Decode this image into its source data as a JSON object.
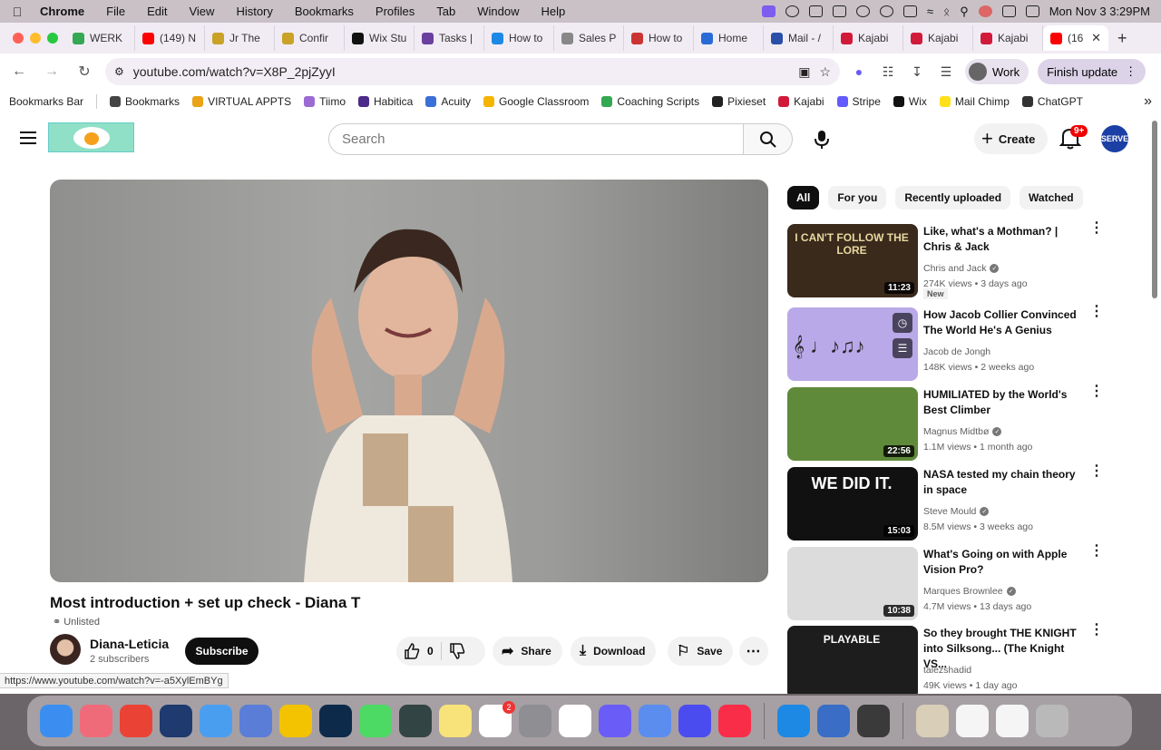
{
  "menubar": {
    "app": "Chrome",
    "items": [
      "File",
      "Edit",
      "View",
      "History",
      "Bookmarks",
      "Profiles",
      "Tab",
      "Window",
      "Help"
    ],
    "datetime": "Mon Nov 3  3:29PM"
  },
  "tabs": [
    {
      "label": "WERK",
      "color": "#34a853"
    },
    {
      "label": "(149) N",
      "color": "#ff0000"
    },
    {
      "label": "Jr The",
      "color": "#c9a227"
    },
    {
      "label": "Confir",
      "color": "#c9a227"
    },
    {
      "label": "Wix Stu",
      "color": "#111111"
    },
    {
      "label": "Tasks |",
      "color": "#6b3fa0"
    },
    {
      "label": "How to",
      "color": "#1e88e5"
    },
    {
      "label": "Sales P",
      "color": "#888888"
    },
    {
      "label": "How to",
      "color": "#cc3333"
    },
    {
      "label": "Home",
      "color": "#2a6ad6"
    },
    {
      "label": "Mail - /",
      "color": "#2a4fa8"
    },
    {
      "label": "Kajabi",
      "color": "#d11a3a"
    },
    {
      "label": "Kajabi",
      "color": "#d11a3a"
    },
    {
      "label": "Kajabi",
      "color": "#d11a3a"
    },
    {
      "label": "(16",
      "color": "#ff0000",
      "active": true
    }
  ],
  "toolbar": {
    "url": "youtube.com/watch?v=X8P_2pjZyyI",
    "profile_label": "Work",
    "update_label": "Finish update"
  },
  "bookmarks": [
    {
      "label": "Bookmarks Bar",
      "color": ""
    },
    {
      "label": "Bookmarks",
      "color": "#444444"
    },
    {
      "label": "VIRTUAL APPTS",
      "color": "#e8a317"
    },
    {
      "label": "Tiimo",
      "color": "#9b6bd3"
    },
    {
      "label": "Habitica",
      "color": "#4b2a8a"
    },
    {
      "label": "Acuity",
      "color": "#3b6fd8"
    },
    {
      "label": "Google Classroom",
      "color": "#f4b400"
    },
    {
      "label": "Coaching Scripts",
      "color": "#34a853"
    },
    {
      "label": "Pixieset",
      "color": "#222222"
    },
    {
      "label": "Kajabi",
      "color": "#d11a3a"
    },
    {
      "label": "Stripe",
      "color": "#635bff"
    },
    {
      "label": "Wix",
      "color": "#111111"
    },
    {
      "label": "Mail Chimp",
      "color": "#ffe01b"
    },
    {
      "label": "ChatGPT",
      "color": "#333333"
    }
  ],
  "youtube": {
    "search_placeholder": "Search",
    "create_label": "Create",
    "notification_count": "9+",
    "avatar_text": "SERVE"
  },
  "video": {
    "title": "Most introduction + set up check - Diana T",
    "visibility": "Unlisted",
    "channel": "Diana-Leticia",
    "subscribers": "2 subscribers",
    "subscribe_label": "Subscribe",
    "likes": "0",
    "share_label": "Share",
    "download_label": "Download",
    "save_label": "Save"
  },
  "chips": [
    "All",
    "For you",
    "Recently uploaded",
    "Watched"
  ],
  "recommendations": [
    {
      "title": "Like, what's a Mothman? | Chris & Jack",
      "channel": "Chris and Jack",
      "verified": true,
      "meta": "274K views • 3 days ago",
      "duration": "11:23",
      "badge": "New",
      "thumb": "#3a2a1c"
    },
    {
      "title": "How Jacob Collier Convinced The World He's A Genius",
      "channel": "Jacob de Jongh",
      "verified": false,
      "meta": "148K views • 2 weeks ago",
      "duration": "",
      "badge": "",
      "thumb": "#b9a9e8"
    },
    {
      "title": "HUMILIATED by the World's Best Climber",
      "channel": "Magnus Midtbø",
      "verified": true,
      "meta": "1.1M views • 1 month ago",
      "duration": "22:56",
      "badge": "",
      "thumb": "#5e8a3a"
    },
    {
      "title": "NASA tested my chain theory in space",
      "channel": "Steve Mould",
      "verified": true,
      "meta": "8.5M views • 3 weeks ago",
      "duration": "15:03",
      "badge": "",
      "thumb": "#111111"
    },
    {
      "title": "What's Going on with Apple Vision Pro?",
      "channel": "Marques Brownlee",
      "verified": true,
      "meta": "4.7M views • 13 days ago",
      "duration": "10:38",
      "badge": "",
      "thumb": "#dcdcdc"
    },
    {
      "title": "So they brought THE KNIGHT into Silksong... (The Knight VS...",
      "channel": "talezshadid",
      "verified": false,
      "meta": "49K views • 1 day ago",
      "duration": "",
      "badge": "",
      "thumb": "#1d1d1d"
    }
  ],
  "thumb_text": {
    "r0": "I CAN'T FOLLOW THE LORE",
    "r3": "WE DID IT.",
    "r5": "PLAYABLE"
  },
  "status_url": "https://www.youtube.com/watch?v=-a5XylEmBYg",
  "dock": [
    {
      "name": "finder",
      "color": "#3b8ef0"
    },
    {
      "name": "safari-like",
      "color": "#f06b7a"
    },
    {
      "name": "chrome",
      "color": "#ea4335"
    },
    {
      "name": "telegram-like",
      "color": "#1e3a6e"
    },
    {
      "name": "mail",
      "color": "#4a9ef0"
    },
    {
      "name": "app",
      "color": "#5a7dd8"
    },
    {
      "name": "sketch-like",
      "color": "#f3c200"
    },
    {
      "name": "lightroom",
      "color": "#0d2a4a"
    },
    {
      "name": "messages",
      "color": "#4cd964"
    },
    {
      "name": "davinci",
      "color": "#344"
    },
    {
      "name": "notes",
      "color": "#f8e27a"
    },
    {
      "name": "reminders",
      "color": "#ffffff",
      "badge": "2"
    },
    {
      "name": "settings",
      "color": "#8e8e93"
    },
    {
      "name": "chatgpt",
      "color": "#ffffff"
    },
    {
      "name": "app2",
      "color": "#6a5cf6"
    },
    {
      "name": "app3",
      "color": "#5b8def"
    },
    {
      "name": "app4",
      "color": "#4b4cf0"
    },
    {
      "name": "music",
      "color": "#fa2d48"
    },
    {
      "name": "app5",
      "color": "#1e88e5"
    },
    {
      "name": "app6",
      "color": "#3a6dc5"
    },
    {
      "name": "calculator",
      "color": "#3a3a3a"
    },
    {
      "name": "doc",
      "color": "#d9cfb8"
    },
    {
      "name": "window1",
      "color": "#f5f5f5"
    },
    {
      "name": "window2",
      "color": "#f5f5f5"
    },
    {
      "name": "trash",
      "color": "#b9b9b9"
    }
  ]
}
